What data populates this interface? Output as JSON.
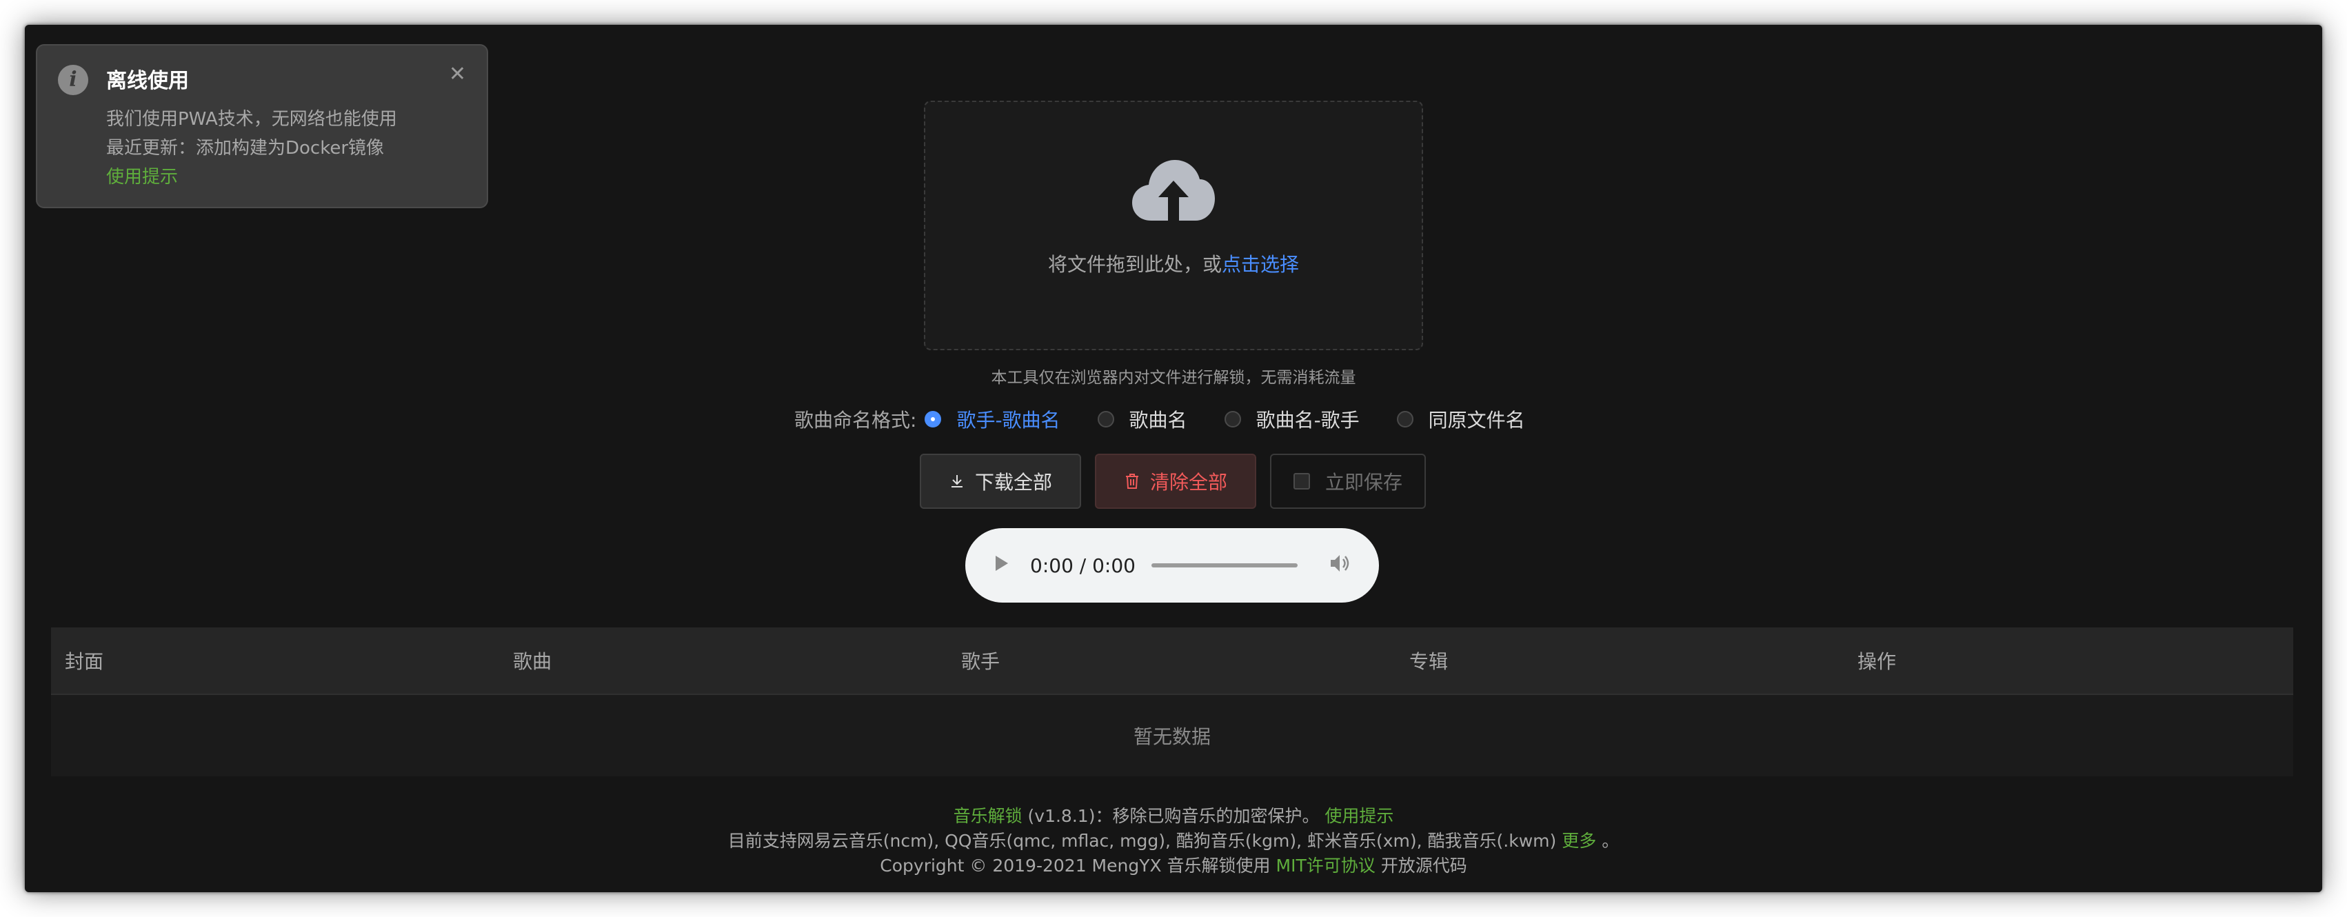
{
  "notification": {
    "title": "离线使用",
    "line1": "我们使用PWA技术，无网络也能使用",
    "line2": "最近更新：添加构建为Docker镜像",
    "link": "使用提示",
    "close_icon": "close-icon",
    "info_icon": "info-icon"
  },
  "upload": {
    "text": "将文件拖到此处，或",
    "link": "点击选择",
    "icon": "cloud-upload-icon",
    "tip": "本工具仅在浏览器内对文件进行解锁，无需消耗流量"
  },
  "naming": {
    "label": "歌曲命名格式:",
    "options": [
      "歌手-歌曲名",
      "歌曲名",
      "歌曲名-歌手",
      "同原文件名"
    ],
    "selected": "歌手-歌曲名"
  },
  "buttons": {
    "download_all": "下载全部",
    "clear_all": "清除全部",
    "save_now": "立即保存"
  },
  "player": {
    "time": "0:00 / 0:00"
  },
  "table": {
    "columns": [
      "封面",
      "歌曲",
      "歌手",
      "专辑",
      "操作"
    ],
    "empty": "暂无数据"
  },
  "footer": {
    "app_name": "音乐解锁",
    "version_text": "(v1.8.1)：移除已购音乐的加密保护。",
    "help_link": "使用提示",
    "support_text": "目前支持网易云音乐(ncm), QQ音乐(qmc, mflac, mgg), 酷狗音乐(kgm), 虾米音乐(xm), 酷我音乐(.kwm)",
    "more_link": "更多",
    "period": "。",
    "copyright": "Copyright © 2019-2021 MengYX 音乐解锁使用",
    "license_link": "MIT许可协议",
    "open_source": "开放源代码"
  },
  "colors": {
    "accent_blue": "#4a8eff",
    "accent_green": "#5fae3c",
    "danger_red": "#f25a5a",
    "background": "#151515"
  }
}
